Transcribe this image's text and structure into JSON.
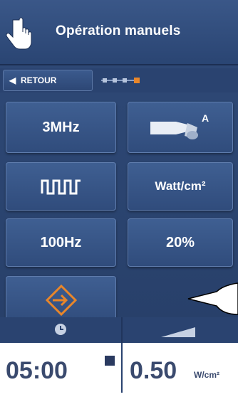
{
  "header": {
    "title": "Opération manuels",
    "icon": "hand-pointer-icon"
  },
  "nav": {
    "back_label": "RETOUR",
    "progress_step": 4,
    "progress_total": 4
  },
  "tiles": {
    "frequency": "3MHz",
    "probe_label": "A",
    "power_unit": "Watt/cm²",
    "pulse_rate": "100Hz",
    "duty_cycle": "20%",
    "mode_icon": "pulsed-wave-icon",
    "enter_icon": "enter-icon"
  },
  "footer": {
    "timer": "05:00",
    "intensity_value": "0.50",
    "intensity_unit": "W/cm²",
    "clock_icon": "clock-icon",
    "ramp_icon": "ramp-icon"
  },
  "colors": {
    "background": "#2a4370",
    "tile": "#3a5788",
    "accent": "#e8862a",
    "text_dark": "#3a4a6e"
  }
}
